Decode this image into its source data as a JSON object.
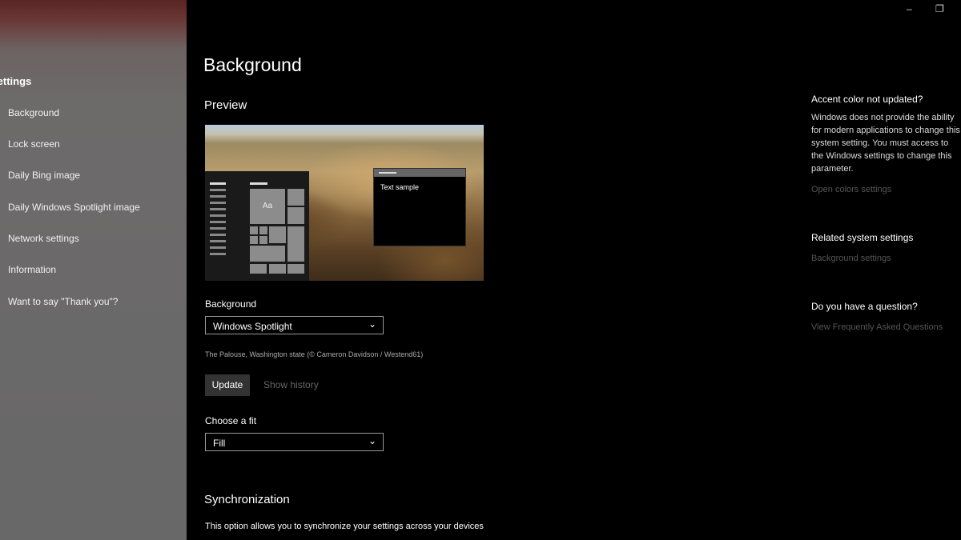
{
  "sidebar": {
    "title": "Settings",
    "items": [
      {
        "label": "Background"
      },
      {
        "label": "Lock screen"
      },
      {
        "label": "Daily Bing image"
      },
      {
        "label": "Daily Windows Spotlight image"
      },
      {
        "label": "Network settings"
      },
      {
        "label": "Information"
      },
      {
        "label": "Want to say \"Thank you\"?"
      }
    ]
  },
  "window_controls": {
    "minimize": "–",
    "restore": "❐"
  },
  "main": {
    "title": "Background",
    "preview": {
      "heading": "Preview",
      "window_text": "Text sample",
      "tile_text": "Aa"
    },
    "background_select": {
      "label": "Background",
      "value": "Windows Spotlight"
    },
    "image_caption": "The Palouse, Washington state (© Cameron Davidson / Westend61)",
    "update_button": "Update",
    "history_link": "Show history",
    "fit_select": {
      "label": "Choose a fit",
      "value": "Fill"
    },
    "sync": {
      "heading": "Synchronization",
      "description": "This option allows you to synchronize your settings across your devices"
    }
  },
  "right_panel": {
    "accent": {
      "title": "Accent color not updated?",
      "text": "Windows does not provide the ability for modern applications to change this system setting. You must access to the Windows settings to change this parameter.",
      "link": "Open colors settings"
    },
    "related": {
      "title": "Related system settings",
      "link": "Background settings"
    },
    "question": {
      "title": "Do you have a question?",
      "link": "View Frequently Asked Questions"
    }
  },
  "colors": {
    "sidebar_bg": "#686868",
    "main_bg": "#000000",
    "button_bg": "#333333",
    "disabled_text": "#666666"
  }
}
